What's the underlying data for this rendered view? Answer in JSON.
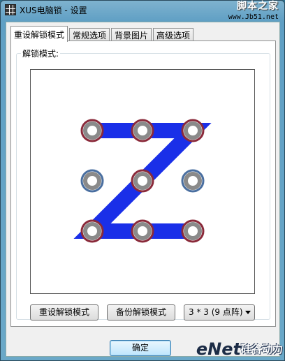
{
  "window": {
    "title": "XUS电脑锁 - 设置",
    "watermark_top_line1": "脚本之家",
    "watermark_top_line2": "www.Jb51.net"
  },
  "tabs": [
    {
      "label": "重设解锁模式",
      "active": true
    },
    {
      "label": "常规选项",
      "active": false
    },
    {
      "label": "背景图片",
      "active": false
    },
    {
      "label": "高级选项",
      "active": false
    }
  ],
  "group": {
    "label": "解锁模式:"
  },
  "pattern": {
    "grid": "3x3",
    "sequence": [
      1,
      2,
      3,
      5,
      7,
      8,
      9
    ],
    "line_color": "#1a2fe8",
    "selected_ring_color": "#8a2a3a",
    "unselected_ring_color": "#4a6fa0"
  },
  "buttons": {
    "reset_label": "重设解锁模式",
    "backup_label": "备份解锁模式",
    "ok_label": "确定"
  },
  "grid_select": {
    "value": "3 * 3 (9 点阵)"
  },
  "watermark_bottom": {
    "brand": "eNet",
    "cn": "硅谷动力"
  }
}
